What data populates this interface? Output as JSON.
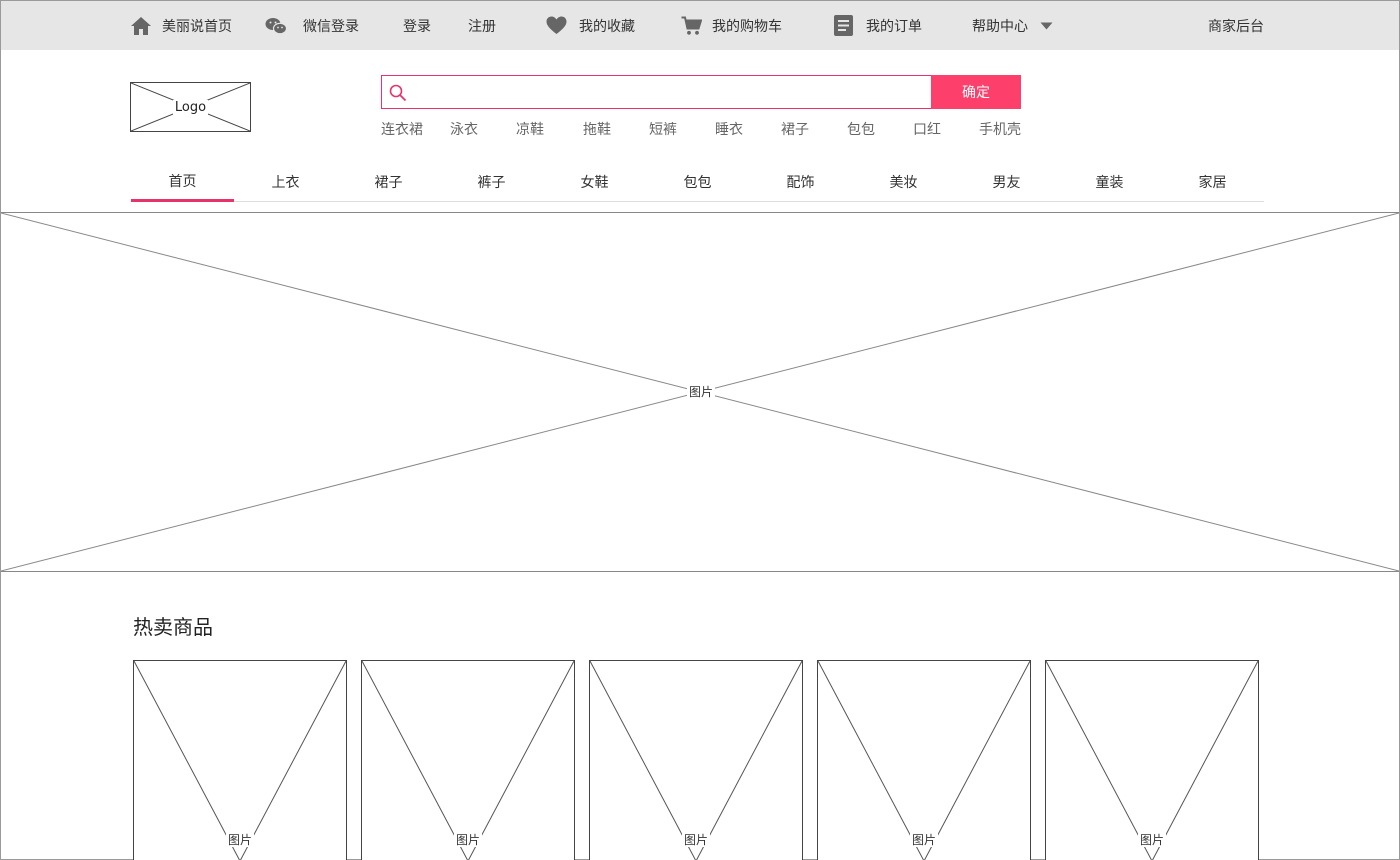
{
  "topbar": {
    "home": {
      "label": "美丽说首页",
      "icon": "home-icon"
    },
    "wechat_login": {
      "label": "微信登录",
      "icon": "wechat-icon"
    },
    "login": {
      "label": "登录"
    },
    "register": {
      "label": "注册"
    },
    "favorites": {
      "label": "我的收藏",
      "icon": "heart-icon"
    },
    "cart": {
      "label": "我的购物车",
      "icon": "cart-icon"
    },
    "orders": {
      "label": "我的订单",
      "icon": "order-list-icon"
    },
    "help": {
      "label": "帮助中心",
      "icon": "chevron-down-icon"
    },
    "merchant": {
      "label": "商家后台"
    }
  },
  "logo": {
    "text": "Logo"
  },
  "search": {
    "placeholder": "",
    "value": "",
    "button_label": "确定",
    "icon": "search-icon",
    "hot_words": [
      "连衣裙",
      "泳衣",
      "凉鞋",
      "拖鞋",
      "短裤",
      "睡衣",
      "裙子",
      "包包",
      "口红",
      "手机壳"
    ]
  },
  "category_nav": {
    "active_index": 0,
    "items": [
      "首页",
      "上衣",
      "裙子",
      "裤子",
      "女鞋",
      "包包",
      "配饰",
      "美妆",
      "男友",
      "童装",
      "家居"
    ]
  },
  "banner": {
    "label": "图片"
  },
  "hot_products": {
    "title": "热卖商品",
    "items": [
      {
        "label": "图片"
      },
      {
        "label": "图片"
      },
      {
        "label": "图片"
      },
      {
        "label": "图片"
      },
      {
        "label": "图片"
      }
    ]
  },
  "colors": {
    "accent": "#fd3f6c",
    "accent_border": "#e8336a",
    "topbar_bg": "#e6e6e6",
    "icon_gray": "#666666"
  }
}
